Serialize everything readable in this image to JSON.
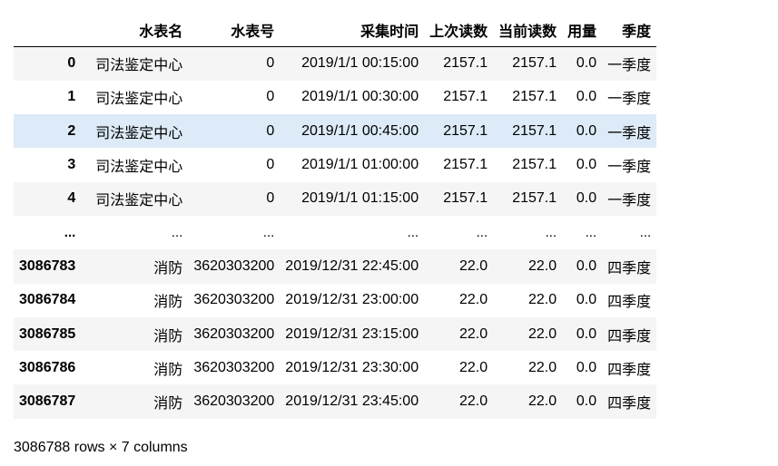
{
  "table": {
    "columns": [
      "水表名",
      "水表号",
      "采集时间",
      "上次读数",
      "当前读数",
      "用量",
      "季度"
    ],
    "rows": [
      {
        "index": "0",
        "cells": [
          "司法鉴定中心",
          "0",
          "2019/1/1 00:15:00",
          "2157.1",
          "2157.1",
          "0.0",
          "一季度"
        ]
      },
      {
        "index": "1",
        "cells": [
          "司法鉴定中心",
          "0",
          "2019/1/1 00:30:00",
          "2157.1",
          "2157.1",
          "0.0",
          "一季度"
        ]
      },
      {
        "index": "2",
        "cells": [
          "司法鉴定中心",
          "0",
          "2019/1/1 00:45:00",
          "2157.1",
          "2157.1",
          "0.0",
          "一季度"
        ]
      },
      {
        "index": "3",
        "cells": [
          "司法鉴定中心",
          "0",
          "2019/1/1 01:00:00",
          "2157.1",
          "2157.1",
          "0.0",
          "一季度"
        ]
      },
      {
        "index": "4",
        "cells": [
          "司法鉴定中心",
          "0",
          "2019/1/1 01:15:00",
          "2157.1",
          "2157.1",
          "0.0",
          "一季度"
        ]
      },
      {
        "index": "...",
        "cells": [
          "...",
          "...",
          "...",
          "...",
          "...",
          "...",
          "..."
        ]
      },
      {
        "index": "3086783",
        "cells": [
          "消防",
          "3620303200",
          "2019/12/31 22:45:00",
          "22.0",
          "22.0",
          "0.0",
          "四季度"
        ]
      },
      {
        "index": "3086784",
        "cells": [
          "消防",
          "3620303200",
          "2019/12/31 23:00:00",
          "22.0",
          "22.0",
          "0.0",
          "四季度"
        ]
      },
      {
        "index": "3086785",
        "cells": [
          "消防",
          "3620303200",
          "2019/12/31 23:15:00",
          "22.0",
          "22.0",
          "0.0",
          "四季度"
        ]
      },
      {
        "index": "3086786",
        "cells": [
          "消防",
          "3620303200",
          "2019/12/31 23:30:00",
          "22.0",
          "22.0",
          "0.0",
          "四季度"
        ]
      },
      {
        "index": "3086787",
        "cells": [
          "消防",
          "3620303200",
          "2019/12/31 23:45:00",
          "22.0",
          "22.0",
          "0.0",
          "四季度"
        ]
      }
    ],
    "hovered_row": 2
  },
  "footer": {
    "shape_text": "3086788 rows × 7 columns"
  },
  "colors": {
    "stripe": "#f5f5f5",
    "hover": "#dcebf7",
    "header_border": "#000000"
  }
}
